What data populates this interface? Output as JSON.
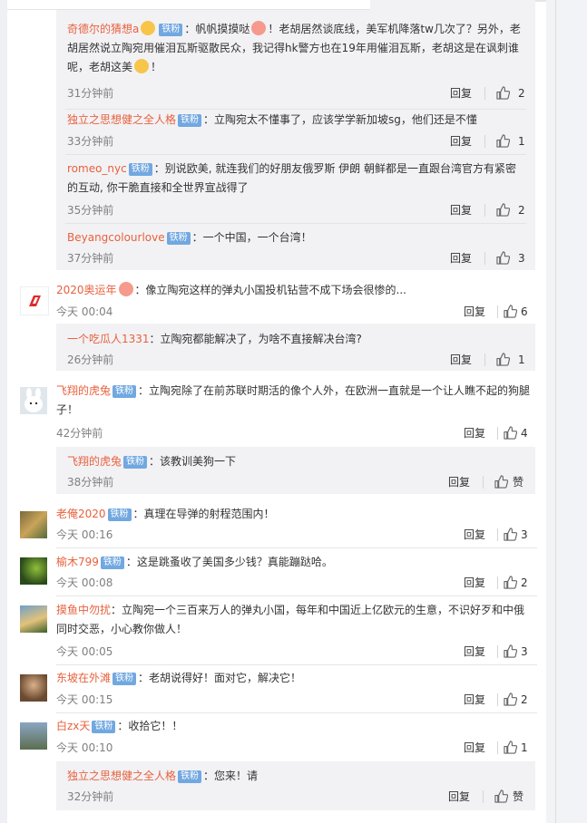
{
  "comments": [
    {
      "kind": "sub",
      "user": "奇德尔的猜想a",
      "badge": "铁粉",
      "text_a": "：帆帆摸摸哒",
      "text_b": "！老胡居然谈底线，美军机降落tw几次了？另外，老胡居然说立陶宛用催泪瓦斯驱散民众，我记得hk警方也在19年用催泪瓦斯，老胡这是在讽刺谁呢，老胡这美",
      "text_c": "！",
      "time": "31分钟前",
      "reply": "回复",
      "likes": "2"
    },
    {
      "kind": "sub",
      "user": "独立之思想健之全人格",
      "badge": "铁粉",
      "text": "：立陶宛太不懂事了，应该学学新加坡sg，他们还是不懂",
      "time": "33分钟前",
      "reply": "回复",
      "likes": "1"
    },
    {
      "kind": "sub",
      "user": "romeo_nyc",
      "badge": "铁粉",
      "text": "：别说欧美, 就连我们的好朋友俄罗斯 伊朗 朝鲜都是一直跟台湾官方有紧密的互动, 你干脆直接和全世界宣战得了",
      "time": "35分钟前",
      "reply": "回复",
      "likes": "2"
    },
    {
      "kind": "sub",
      "user": "Beyangcolourlove",
      "badge": "铁粉",
      "text": "：一个中国，一个台湾！",
      "time": "37分钟前",
      "reply": "回复",
      "likes": "3"
    },
    {
      "kind": "top",
      "user": "2020奥运年",
      "text": "：像立陶宛这样的弹丸小国投机钻营不成下场会很惨的...",
      "time": "今天 00:04",
      "reply": "回复",
      "likes": "6"
    },
    {
      "kind": "sub",
      "user": "一个吃瓜人1331",
      "text": "：立陶宛都能解决了，为啥不直接解决台湾?",
      "time": "26分钟前",
      "reply": "回复",
      "likes": "1"
    },
    {
      "kind": "top",
      "user": "飞翔的虎兔",
      "badge": "铁粉",
      "text": "：立陶宛除了在前苏联时期活的像个人外，在欧洲一直就是一个让人瞧不起的狗腿子！",
      "time": "42分钟前",
      "reply": "回复",
      "likes": "4"
    },
    {
      "kind": "sub",
      "user": "飞翔的虎兔",
      "badge": "铁粉",
      "text": "：该教训美狗一下",
      "time": "38分钟前",
      "reply": "回复",
      "likes": "赞"
    },
    {
      "kind": "top",
      "user": "老俺2020",
      "badge": "铁粉",
      "text": "：真理在导弹的射程范围内！",
      "time": "今天 00:16",
      "reply": "回复",
      "likes": "3"
    },
    {
      "kind": "top",
      "user": "榆木799",
      "badge": "铁粉",
      "text": "：这是跳蚤收了美国多少钱？真能蹦跶哈。",
      "time": "今天 00:08",
      "reply": "回复",
      "likes": "2"
    },
    {
      "kind": "top",
      "user": "摸鱼中勿扰",
      "text": "：立陶宛一个三百来万人的弹丸小国，每年和中国近上亿欧元的生意，不识好歹和中俄同时交恶，小心教你做人！",
      "time": "今天 00:05",
      "reply": "回复",
      "likes": "3"
    },
    {
      "kind": "top",
      "user": "东坡在外滩",
      "badge": "铁粉",
      "text": "：老胡说得好！面对它，解决它！",
      "time": "今天 00:15",
      "reply": "回复",
      "likes": "2"
    },
    {
      "kind": "top",
      "user": "白zx天",
      "badge": "铁粉",
      "text": "：收拾它！！",
      "time": "今天 00:10",
      "reply": "回复",
      "likes": "1"
    },
    {
      "kind": "sub",
      "user": "独立之思想健之全人格",
      "badge": "铁粉",
      "text": "：您来！请",
      "time": "32分钟前",
      "reply": "回复",
      "likes": "赞"
    }
  ],
  "colors": {
    "username": "#e8613d",
    "badge": "#72a8e0",
    "reply_bg": "#f2f2f5",
    "timestamp": "#808080"
  },
  "icons": {
    "like": "thumbs-up-icon",
    "emoji": "emoji-icon",
    "avatar": "avatar"
  }
}
